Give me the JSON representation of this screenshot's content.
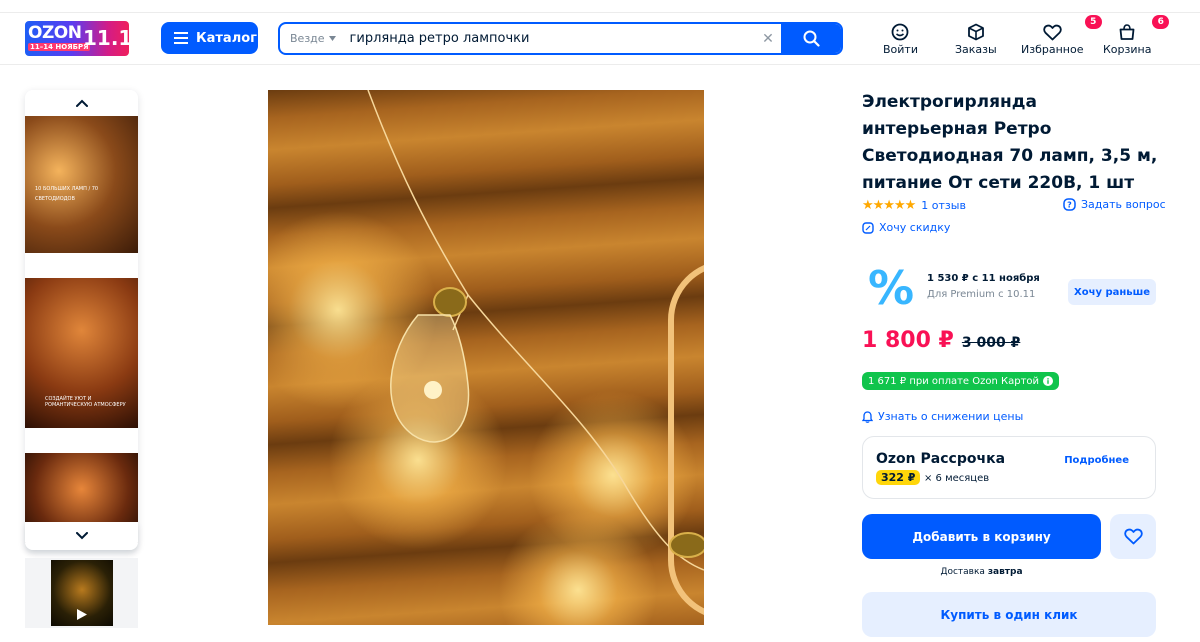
{
  "header": {
    "logo": {
      "brand": "OZON",
      "dates": "11–14 НОЯБРЯ",
      "event": "11.11"
    },
    "catalog_label": "Каталог",
    "search": {
      "scope": "Везде",
      "query": "гирлянда ретро лампочки"
    },
    "nav": [
      {
        "icon": "smile-icon",
        "label": "Войти"
      },
      {
        "icon": "box-icon",
        "label": "Заказы"
      },
      {
        "icon": "heart-icon",
        "label": "Избранное",
        "badge": "5"
      },
      {
        "icon": "bag-icon",
        "label": "Корзина",
        "badge": "6"
      }
    ]
  },
  "gallery": {
    "thumb1_note": "10 БОЛЬШИХ ЛАМП / 70 СВЕТОДИОДОВ",
    "thumb2_note": "СОЗДАЙТЕ УЮТ И РОМАНТИЧЕСКУЮ АТМОСФЕРУ"
  },
  "product": {
    "title": "Электрогирлянда интерьерная Ретро Светодиодная 70 ламп, 3,5 м, питание От сети 220В, 1 шт",
    "rating_stars": 5,
    "reviews": "1 отзыв",
    "ask_question": "Задать вопрос",
    "want_discount": "Хочу скидку",
    "promo": {
      "line1": "1 530 ₽ с 11 ноября",
      "line2": "Для Premium с 10.11",
      "button": "Хочу раньше"
    },
    "price": "1 800 ₽",
    "old_price": "3 000 ₽",
    "card_price": "1 671 ₽ при оплате Ozon Картой",
    "price_drop": "Узнать о снижении цены",
    "installment": {
      "name": "Ozon Рассрочка",
      "more": "Подробнее",
      "amount": "322 ₽",
      "months": "× 6 месяцев"
    },
    "add_to_cart": "Добавить в корзину",
    "delivery_label": "Доставка",
    "delivery_day": "завтра",
    "buy_one_click": "Купить в один клик"
  },
  "colors": {
    "accent": "#005bff",
    "price": "#f91155",
    "card_badge": "#10c44c",
    "installment_badge": "#ffd60a"
  }
}
